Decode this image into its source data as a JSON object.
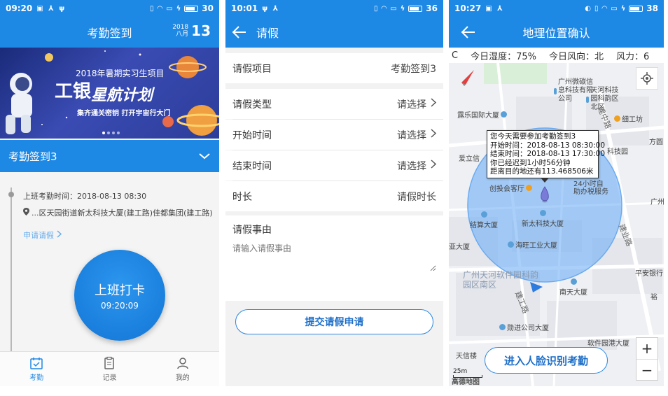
{
  "panel1": {
    "status": {
      "time": "09:20",
      "battery": "30"
    },
    "title": "考勤签到",
    "date": {
      "year": "2018",
      "month": "八月",
      "day": "13"
    },
    "banner": {
      "title": "2018年暑期实习生项目",
      "logo": "工银",
      "slogan": "星航计划",
      "sub": "集齐通关密钥  打开宇宙行大门"
    },
    "task": "考勤签到3",
    "checkin_time": "上班考勤时间：2018-08-13 08:30",
    "location": "...区天园街道新太科技大厦(建工路)佳都集团(建工路)",
    "leave_link": "申请请假",
    "punch": {
      "label": "上班打卡",
      "time": "09:20:09"
    },
    "tabs": [
      {
        "label": "考勤",
        "icon": "calendar-check-icon"
      },
      {
        "label": "记录",
        "icon": "clipboard-icon"
      },
      {
        "label": "我的",
        "icon": "user-icon"
      }
    ]
  },
  "panel2": {
    "status": {
      "time": "10:01",
      "battery": "36"
    },
    "title": "请假",
    "project": {
      "label": "请假项目",
      "value": "考勤签到3"
    },
    "type": {
      "label": "请假类型",
      "value": "请选择"
    },
    "start": {
      "label": "开始时间",
      "value": "请选择"
    },
    "end": {
      "label": "结束时间",
      "value": "请选择"
    },
    "duration": {
      "label": "时长",
      "value": "请假时长"
    },
    "reason": {
      "label": "请假事由",
      "placeholder": "请输入请假事由"
    },
    "submit": "提交请假申请"
  },
  "panel3": {
    "status": {
      "time": "10:27",
      "battery": "38"
    },
    "title": "地理位置确认",
    "weather": {
      "c": "C",
      "humidity": "今日湿度：75%",
      "wind": "今日风向：北",
      "power": "风力：6"
    },
    "popup": [
      "您今天需要参加考勤签到3",
      "开始时间：2018-08-13 08:30:00",
      "结束时间：2018-08-13 17:30:00",
      "你已经迟到1小时56分钟",
      "距离目的地还有113.468506米"
    ],
    "pois": {
      "weikong": "广州微碳信息科技有限公司",
      "tianhe_park": "天河科技园科韵区北区",
      "dusheng": "露乐国际大厦",
      "xigongfang": "细工坊",
      "aili": "爱立信",
      "kejiyuan": "科技园",
      "fangyuan": "方圆",
      "chuangyi": "创投会客厅",
      "zhuzhu": "24小时自助办税服务",
      "jiesuan": "结算大厦",
      "xintai": "新太科技大厦",
      "haiwang": "海旺工业大厦",
      "ya": "亚大厦",
      "ruanjian": "广州天河软件园科韵园区南区",
      "nantian": "南天大厦",
      "pingan": "平安银行",
      "yu": "裕",
      "jinjin": "勋进公司大厦",
      "tianxin": "天信楼",
      "ruanjian_gang": "软件园港大厦",
      "guangzhou": "广州",
      "zhongshan": "中山",
      "jiangong_road": "建中路",
      "jianyi_road": "建业路",
      "jiangong_road2": "建工路"
    },
    "face_button": "进入人脸识别考勤",
    "scale": "25m",
    "map_logo": "高德地图"
  }
}
